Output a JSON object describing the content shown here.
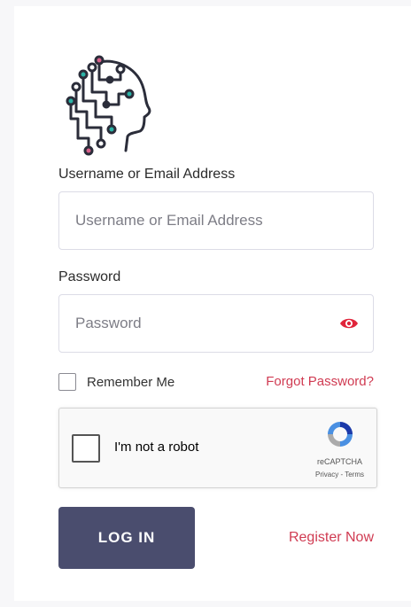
{
  "logo": {
    "icon": "ai-head-circuit-icon",
    "colors": {
      "stroke": "#2b2d3a",
      "teal": "#2bb3a6",
      "pink": "#d8608a"
    }
  },
  "username": {
    "label": "Username or Email Address",
    "placeholder": "Username or Email Address",
    "value": ""
  },
  "password": {
    "label": "Password",
    "placeholder": "Password",
    "value": "",
    "toggle_icon": "eye-icon",
    "toggle_color": "#e0243a"
  },
  "remember": {
    "label": "Remember Me",
    "checked": false
  },
  "forgot": {
    "label": "Forgot Password?"
  },
  "recaptcha": {
    "prompt": "I'm not a robot",
    "brand": "reCAPTCHA",
    "links": "Privacy - Terms",
    "checked": false
  },
  "login": {
    "label": "LOG IN"
  },
  "register": {
    "label": "Register Now"
  },
  "colors": {
    "button": "#4a4d6e",
    "link": "#d03b52",
    "border": "#dcdce6"
  }
}
